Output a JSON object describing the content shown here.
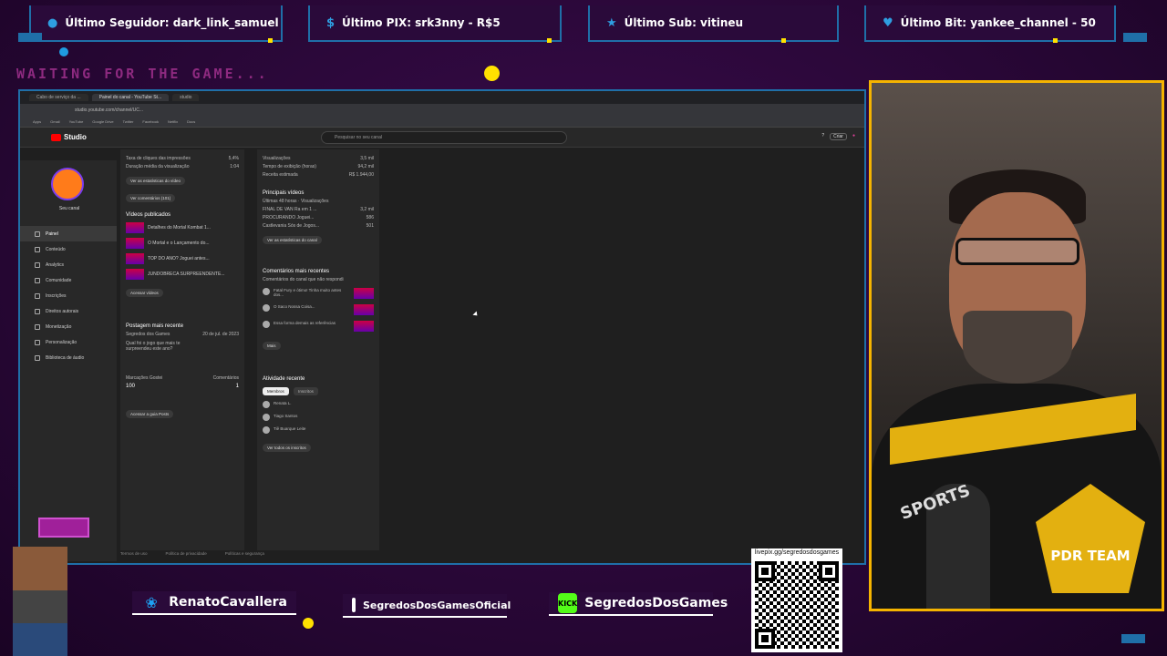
{
  "alerts": [
    {
      "icon": "user-icon",
      "label": "Último Seguidor: dark_link_samuel"
    },
    {
      "icon": "dollar-icon",
      "label": "Último PIX: srk3nny - R$5"
    },
    {
      "icon": "star-icon",
      "label": "Último Sub: vitineu"
    },
    {
      "icon": "heart-icon",
      "label": "Último Bit: yankee_channel - 50"
    }
  ],
  "waiting_text": "WAITING FOR THE GAME...",
  "browser": {
    "tabs": [
      "Cabo de serviço da ...",
      "Painel do canal - YouTube St...",
      "studio"
    ],
    "url": "studio.youtube.com/channel/UC...",
    "bookmarks": [
      "Apps",
      "Gmail",
      "YouTube",
      "Google Drive",
      "Twitter",
      "Facebook",
      "Netflix",
      "Docs"
    ]
  },
  "studio": {
    "logo_text": "Studio",
    "search_placeholder": "Pesquisar no seu canal",
    "create_label": "Criar",
    "channel_name": "Seu canal",
    "nav": [
      "Painel",
      "Conteúdo",
      "Analytics",
      "Comunidade",
      "Inscrições",
      "Direitos autorais",
      "Monetização",
      "Personalização",
      "Biblioteca de áudio"
    ],
    "col1": {
      "stats_rows": [
        [
          "Taxa de cliques das impressões",
          "5,4%"
        ],
        [
          "Duração média da visualização",
          "1:04"
        ]
      ],
      "btn_video_stats": "Ver as estatísticas do vídeo",
      "btn_comments": "Ver comentários (101)",
      "published_title": "Vídeos publicados",
      "published": [
        "Detalhes do Mortal Kombat 1...",
        "O Mortal e o Lançamento do...",
        "TOP DO ANO? Joguei antes...",
        "JUNDOBRECA SURPREENDENTE..."
      ],
      "btn_all_videos": "Acessar vídeos",
      "latest_post_title": "Postagem mais recente",
      "latest_post_channel": "Segredos dos Games",
      "latest_post_date": "20 de jul. de 2023",
      "latest_post_text": "Qual foi o jogo que mais te surpreendeu este ano?",
      "likes_label": "Marcações Gostei",
      "likes_value": "100",
      "comments_label": "Comentários",
      "comments_value": "1",
      "btn_post": "Acessar a guia Posts"
    },
    "col2": {
      "stats_rows": [
        [
          "Visualizações",
          "3,5 mil"
        ],
        [
          "Tempo de exibição (horas)",
          "94,2 mil"
        ],
        [
          "Receita estimada",
          "R$ 1.944,00"
        ]
      ],
      "top_videos_title": "Principais vídeos",
      "top_videos_sub": "Últimas 48 horas · Visualizações",
      "top_videos": [
        [
          "FINAL DE VAN Ra em 1 ...",
          "3,2 mil"
        ],
        [
          "PROCURANDO Joguei...",
          "586"
        ],
        [
          "Castlevania Sós de Jogos...",
          "501"
        ]
      ],
      "btn_channel_stats": "Ver as estatísticas do canal",
      "comments_title": "Comentários mais recentes",
      "comments_sub": "Comentários do canal que não respondi",
      "comments": [
        "Fatal Fury e ótimo! Tinha muito antes dos...",
        "O Saco Nossa Coisa...",
        "Essa forma demais as referências"
      ],
      "btn_more": "Mais",
      "activity_title": "Atividade recente",
      "chip_on": "Membros",
      "chip_off": "Inscritos",
      "activity": [
        "Renata L.",
        "Tiago Santos",
        "Tiê Buarque Leite"
      ],
      "btn_all_subs": "Ver todos os inscritos"
    },
    "footer": [
      "Termos de uso",
      "Política de privacidade",
      "Políticas e segurança"
    ]
  },
  "social": [
    {
      "icon": "twitter-icon",
      "label": "RenatoCavallera",
      "badge": "t",
      "color": "#1da1f2"
    },
    {
      "icon": "instagram-icon",
      "label": "SegredosDosGamesOficial",
      "badge": "ig",
      "color": "#c13584"
    },
    {
      "icon": "kick-icon",
      "label": "SegredosDosGames",
      "badge": "KICK",
      "color": "#53fc18"
    }
  ],
  "qr_url": "livepix.gg/segredosdosgames",
  "cam": {
    "shirt_text": "SPORTS",
    "logo_text": "PDR TEAM"
  }
}
